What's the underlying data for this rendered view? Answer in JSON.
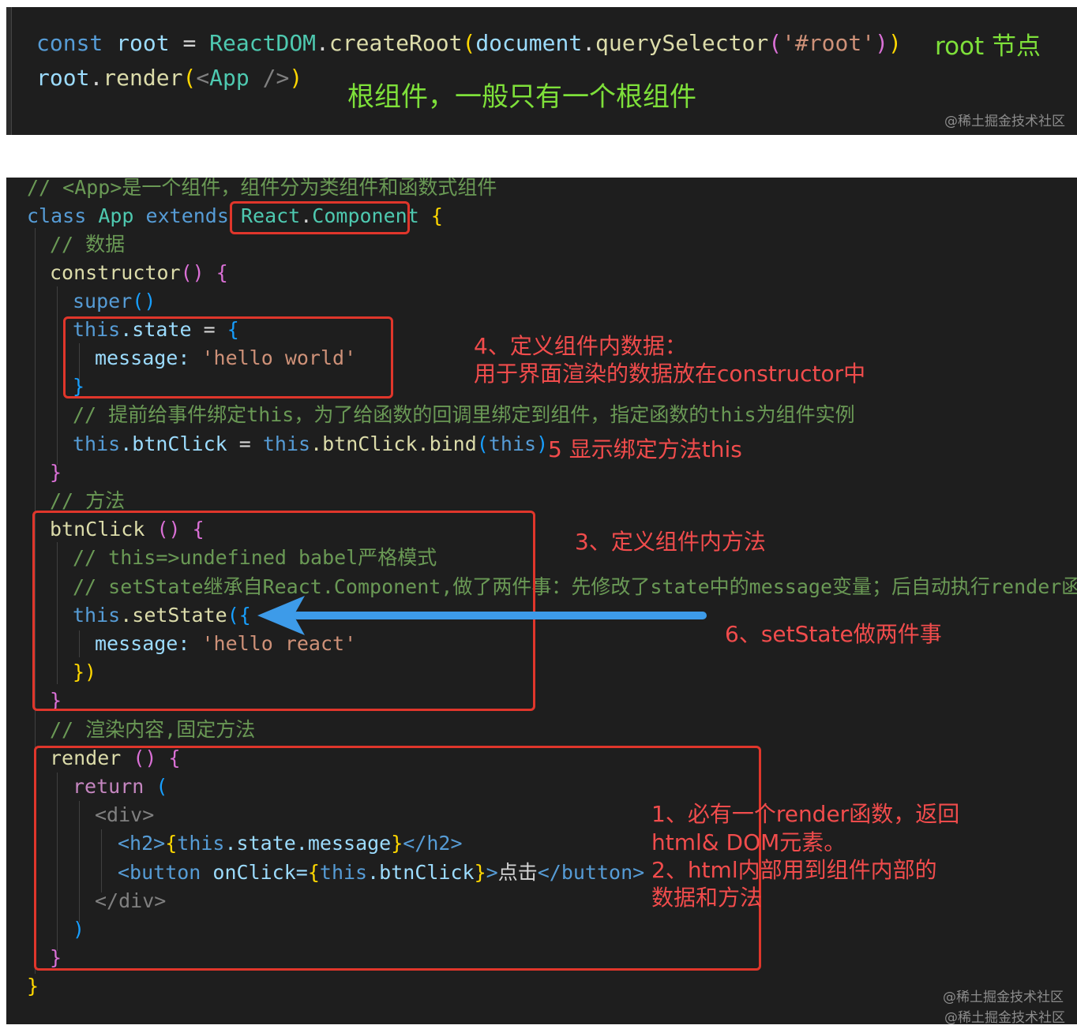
{
  "panel1": {
    "line1": {
      "const": "const",
      "root": "root",
      "eq": " = ",
      "reactdom": "ReactDOM",
      "dot1": ".",
      "createRoot": "createRoot",
      "paren1": "(",
      "document": "document",
      "dot2": ".",
      "querySelector": "querySelector",
      "paren2": "(",
      "arg": "'#root'",
      "paren3": ")",
      "paren4": ")"
    },
    "line2": {
      "root": "root",
      "dot": ".",
      "render": "render",
      "paren1": "(",
      "tag_open": "<",
      "app": "App",
      "tag_close": " />",
      "paren2": ")"
    },
    "annotation_root_node": "root 节点",
    "annotation_root_component": "根组件，一般只有一个根组件",
    "watermark": "@稀土掘金技术社区"
  },
  "panel2": {
    "lines": {
      "l1_comment": "// <App>是一个组件，组件分为类组件和函数式组件",
      "l2_class": "class",
      "l2_app": "App",
      "l2_extends": "extends",
      "l2_react": "React",
      "l2_dot": ".",
      "l2_component": "Component",
      "l2_brace": "{",
      "l3_comment": "// 数据",
      "l4_constructor": "constructor",
      "l4_parens": "()",
      "l4_brace": "{",
      "l5_super": "super",
      "l5_parens": "()",
      "l6_this": "this",
      "l6_state": ".state",
      "l6_eq": " = ",
      "l6_brace": "{",
      "l7_key": "message: ",
      "l7_val": "'hello world'",
      "l8_brace": "}",
      "l9_comment": "// 提前给事件绑定this，为了给函数的回调里绑定到组件，指定函数的this为组件实例",
      "l10_this1": "this",
      "l10_prop": ".btnClick",
      "l10_eq": " = ",
      "l10_this2": "this",
      "l10_bind": ".btnClick.bind",
      "l10_p1": "(",
      "l10_this3": "this",
      "l10_p2": ")",
      "l11_brace": "}",
      "l12_comment": "// 方法",
      "l13_name": "btnClick",
      "l13_parens": " ()",
      "l13_brace": "{",
      "l14_comment": "// this=>undefined babel严格模式",
      "l15_comment": "// setState继承自React.Component,做了两件事：先修改了state中的message变量；后自动执行render函数",
      "l16_this": "this",
      "l16_setstate": ".setState",
      "l16_open": "({",
      "l17_key": "message: ",
      "l17_val": "'hello react'",
      "l18_close": "})",
      "l19_brace": "}",
      "l20_comment": "// 渲染内容,固定方法",
      "l21_render": "render",
      "l21_parens": " ()",
      "l21_brace": "{",
      "l22_return": "return",
      "l22_paren": "(",
      "l23_div_open": "<div>",
      "l24_h2_open": "<h2>",
      "l24_expr_open": "{",
      "l24_this": "this",
      "l24_path": ".state.message",
      "l24_expr_close": "}",
      "l24_h2_close": "</h2>",
      "l25_btn_open": "<button",
      "l25_attr": " onClick=",
      "l25_expr_open": "{",
      "l25_this": "this",
      "l25_path": ".btnClick",
      "l25_expr_close": "}",
      "l25_gt": ">",
      "l25_text": "点击",
      "l25_btn_close": "</button>",
      "l26_div_close": "</div>",
      "l27_paren": ")",
      "l28_brace": "}",
      "l29_brace": "}"
    },
    "annotations": {
      "a4_line1": "4、定义组件内数据：",
      "a4_line2": "用于界面渲染的数据放在constructor中",
      "a5": "5 显示绑定方法this",
      "a3": "3、定义组件内方法",
      "a6": "6、setState做两件事",
      "a1_line1": "1、必有一个render函数，返回",
      "a1_line2": "html& DOM元素。",
      "a1_line3": "2、html内部用到组件内部的",
      "a1_line4": "数据和方法"
    },
    "watermark1": "@稀土掘金技术社区",
    "watermark2": "@稀土掘金技术社区"
  },
  "colors": {
    "background": "#1e1e1e",
    "highlight_box": "#e0362b",
    "annotation_red": "#f14c4c",
    "annotation_green": "#7ee03a",
    "arrow_blue": "#3d9be9"
  }
}
